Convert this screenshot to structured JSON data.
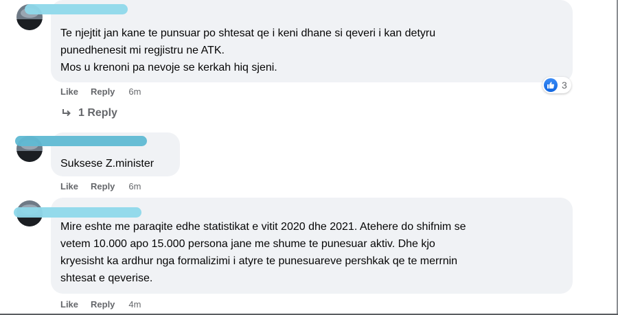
{
  "actions": {
    "like": "Like",
    "reply": "Reply"
  },
  "comments": [
    {
      "text": "Te njejtit jan kane te punsuar po shtesat qe i keni dhane si qeveri i kan detyru\npunedhenesit mi regjistru ne ATK.\nMos u krenoni pa nevoje se kerkah hiq sjeni.",
      "time": "6m",
      "reactions": {
        "icon": "like-icon",
        "count": "3",
        "color": "#1877f2"
      },
      "replies": "1 Reply"
    },
    {
      "text": "Suksese Z.minister",
      "time": "6m"
    },
    {
      "text": "Mire eshte me paraqite edhe statistikat e vitit 2020 dhe 2021. Atehere do shifnim se\nvetem 10.000 apo 15.000 persona jane me shume te punesuar aktiv. Dhe kjo\nkryesisht ka ardhur nga formalizimi i atyre te punesuareve pershkak qe te merrnin\nshtesat e qeverise.",
      "time": "4m"
    }
  ]
}
